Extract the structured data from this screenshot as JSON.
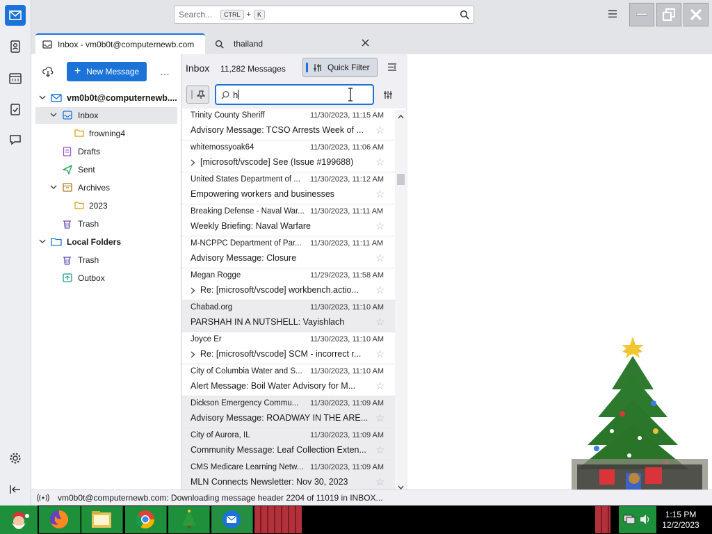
{
  "app": {
    "search_placeholder": "Search...",
    "shortcut_ctrl": "CTRL",
    "shortcut_plus": "+",
    "shortcut_k": "K"
  },
  "tabs": [
    {
      "label": "Inbox - vm0b0t@computernewb.com"
    },
    {
      "label": "thailand"
    }
  ],
  "folder_pane": {
    "new_message": "New Message",
    "more": "…",
    "account": "vm0b0t@computernewb....",
    "folders": [
      {
        "label": "Inbox"
      },
      {
        "label": "frowning4"
      },
      {
        "label": "Drafts"
      },
      {
        "label": "Sent"
      },
      {
        "label": "Archives"
      },
      {
        "label": "2023"
      },
      {
        "label": "Trash"
      }
    ],
    "local_folders": "Local Folders",
    "local": [
      {
        "label": "Trash"
      },
      {
        "label": "Outbox"
      }
    ]
  },
  "list": {
    "folder_name": "Inbox",
    "count": "11,282 Messages",
    "quick_filter": "Quick Filter",
    "filter_value": "h",
    "messages": [
      {
        "sender": "Trinity County Sheriff",
        "date": "11/30/2023, 11:15 AM",
        "subject": "Advisory Message: TCSO Arrests Week of ...",
        "thread": false
      },
      {
        "sender": "whitemossyoak64",
        "date": "11/30/2023, 11:06 AM",
        "subject": "[microsoft/vscode] See (Issue #199688)",
        "thread": true
      },
      {
        "sender": "United States Department of ...",
        "date": "11/30/2023, 11:12 AM",
        "subject": "Empowering workers and businesses",
        "thread": false
      },
      {
        "sender": "Breaking Defense - Naval War...",
        "date": "11/30/2023, 11:11 AM",
        "subject": "Weekly Briefing: Naval Warfare",
        "thread": false
      },
      {
        "sender": "M-NCPPC Department of Par...",
        "date": "11/30/2023, 11:11 AM",
        "subject": "Advisory Message: Closure",
        "thread": false
      },
      {
        "sender": "Megan Rogge",
        "date": "11/29/2023, 11:58 AM",
        "subject": "Re: [microsoft/vscode] workbench.actio...",
        "thread": true
      },
      {
        "sender": "Chabad.org",
        "date": "11/30/2023, 11:10 AM",
        "subject": "PARSHAH IN A NUTSHELL: Vayishlach",
        "thread": false
      },
      {
        "sender": "Joyce Er",
        "date": "11/30/2023, 11:10 AM",
        "subject": "Re: [microsoft/vscode] SCM - incorrect r...",
        "thread": true
      },
      {
        "sender": "City of Columbia Water and S...",
        "date": "11/30/2023, 11:10 AM",
        "subject": "Alert Message: Boil Water Advisory for M...",
        "thread": false
      },
      {
        "sender": "Dickson Emergency Commu...",
        "date": "11/30/2023, 11:09 AM",
        "subject": "Advisory Message: ROADWAY IN THE ARE...",
        "thread": false
      },
      {
        "sender": "City of Aurora, IL",
        "date": "11/30/2023, 11:09 AM",
        "subject": "Community Message: Leaf Collection Exten...",
        "thread": false
      },
      {
        "sender": "CMS Medicare Learning Netw...",
        "date": "11/30/2023, 11:09 AM",
        "subject": "MLN Connects Newsletter: Nov 30, 2023",
        "thread": false
      }
    ]
  },
  "status": {
    "text": "vm0b0t@computernewb.com: Downloading message header 2204 of 11019 in INBOX..."
  },
  "taskbar": {
    "time": "1:15 PM",
    "date": "12/2/2023"
  },
  "colors": {
    "accent": "#1b73d8",
    "taskbar_green": "#1e8f3a"
  }
}
